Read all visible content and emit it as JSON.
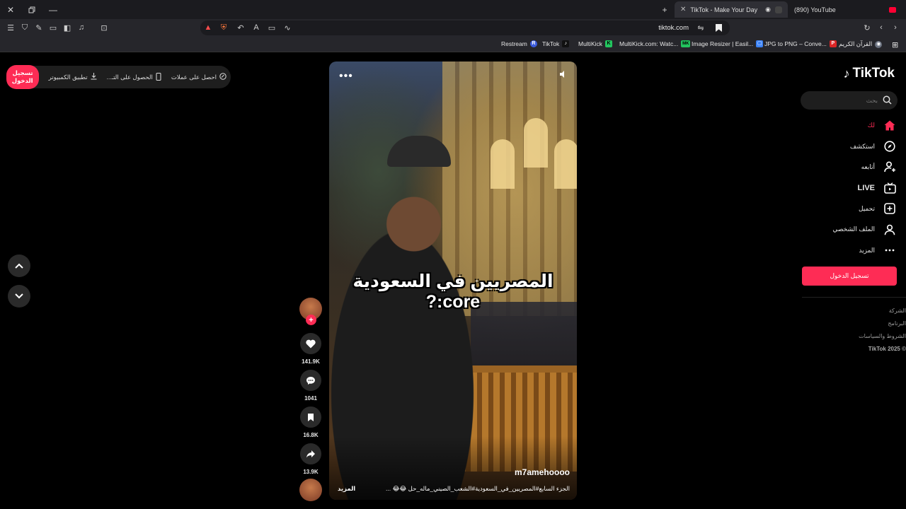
{
  "browser": {
    "tabs": [
      {
        "label": "TikTok - Make Your Day",
        "active": true
      },
      {
        "label": "(890) YouTube",
        "active": false
      }
    ],
    "url": "tiktok.com",
    "bookmarks": [
      {
        "label": "Restream",
        "icon": "R",
        "color": "#3b5bdb"
      },
      {
        "label": "TikTok",
        "icon": "♪",
        "color": "#111111"
      },
      {
        "label": "MultiKick",
        "icon": "K",
        "color": "#22c55e"
      },
      {
        "label": "MultiKick.com: Watc...",
        "icon": "MK",
        "color": "#22c55e"
      },
      {
        "label": "Image Resizer | Easil...",
        "icon": "▢",
        "color": "#3b82f6"
      },
      {
        "label": "JPG to PNG – Conve...",
        "icon": "P",
        "color": "#dc2626"
      },
      {
        "label": "القرآن الكريم",
        "icon": "◉",
        "color": "#6b7280"
      }
    ]
  },
  "top_actions": {
    "coins": "احصل على عملات",
    "get_app": "الحصول على التـ...",
    "desktop_app": "تطبيق الكمبيوتر",
    "login": "تسجيل الدخول"
  },
  "video": {
    "overlay_text": "المصريين في السعودية core:?",
    "author": "m7amehoooo",
    "description": "الجزء السابع#المصريين_في_السعودية#الشعب_الصيني_ماله_حل 😂😂 ...",
    "more": "المزيد"
  },
  "rail": {
    "likes": "141.9K",
    "comments": "1041",
    "saves": "16.8K",
    "shares": "13.9K"
  },
  "sidebar": {
    "logo": "TikTok",
    "search_placeholder": "بحث",
    "items": [
      {
        "label": "لك",
        "icon": "home-icon",
        "active": true
      },
      {
        "label": "استكشف",
        "icon": "compass-icon",
        "active": false
      },
      {
        "label": "أتابعه",
        "icon": "user-plus-icon",
        "active": false
      },
      {
        "label": "LIVE",
        "icon": "live-tv-icon",
        "active": false
      },
      {
        "label": "تحميل",
        "icon": "upload-icon",
        "active": false
      },
      {
        "label": "الملف الشخصي",
        "icon": "profile-icon",
        "active": false
      },
      {
        "label": "المزيد",
        "icon": "more-icon",
        "active": false
      }
    ],
    "login_button": "تسجيل الدخول",
    "footer": [
      "الشركة",
      "البرنامج",
      "الشروط والسياسات",
      "© 2025 TikTok"
    ]
  },
  "colors": {
    "accent": "#fe2c55",
    "background": "#000000",
    "panel": "#1e1e1e"
  }
}
